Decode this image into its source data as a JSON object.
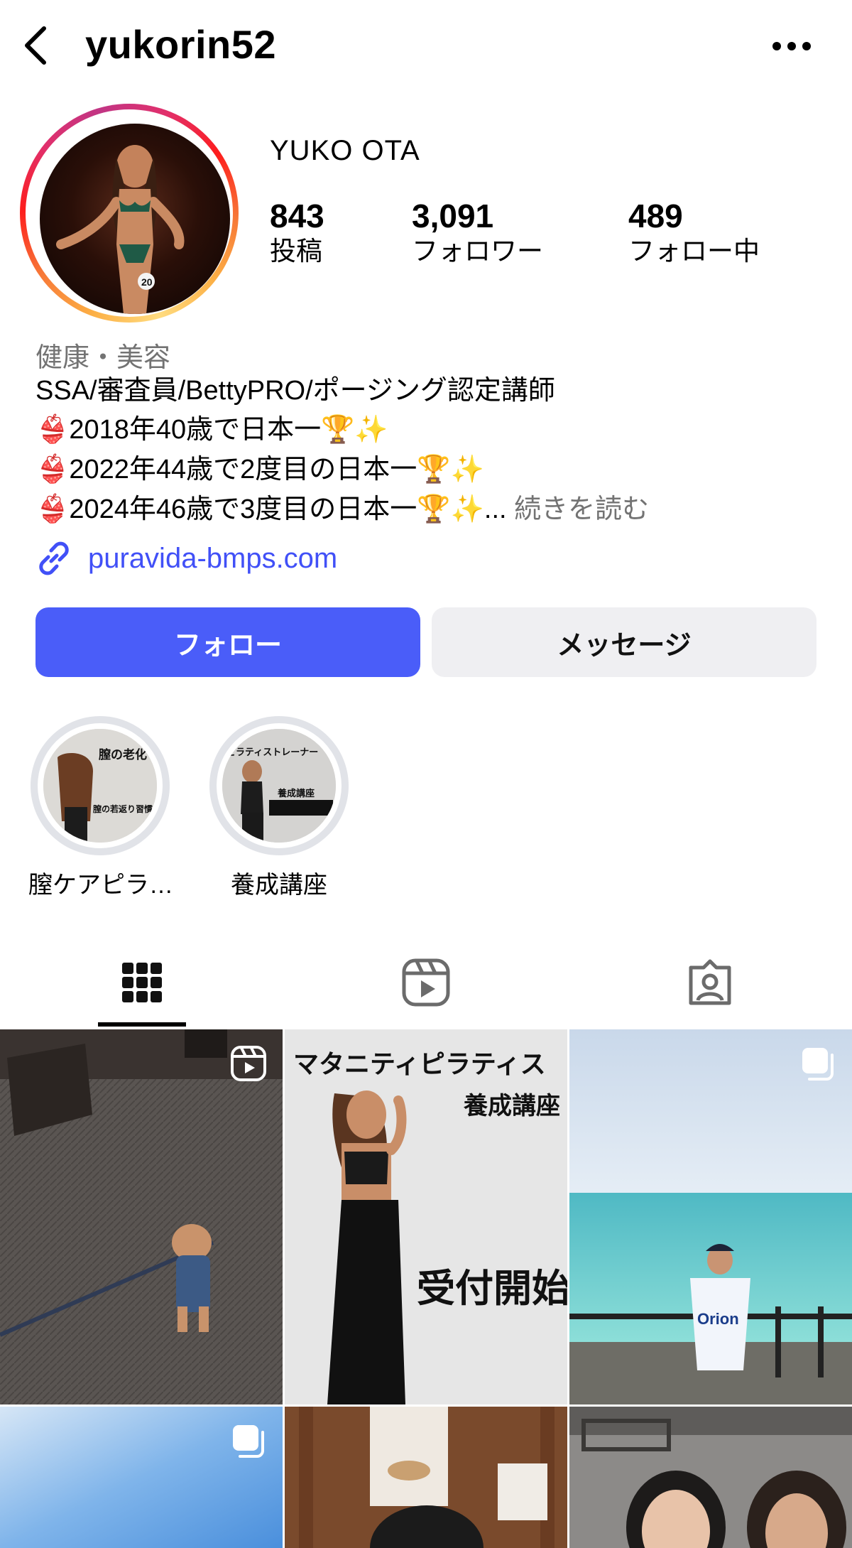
{
  "header": {
    "username": "yukorin52"
  },
  "profile": {
    "display_name": "YUKO OTA",
    "stats": [
      {
        "value": "843",
        "label": "投稿"
      },
      {
        "value": "3,091",
        "label": "フォロワー"
      },
      {
        "value": "489",
        "label": "フォロー中"
      }
    ],
    "category": "健康・美容",
    "bio_lines": [
      "SSA/審査員/BettyPRO/ポージング認定講師",
      "👙2018年40歳で日本一🏆✨",
      "👙2022年44歳で2度目の日本一🏆✨",
      "👙2024年46歳で3度目の日本一🏆✨..."
    ],
    "read_more": "続きを読む",
    "link": "puravida-bmps.com"
  },
  "actions": {
    "follow_label": "フォロー",
    "message_label": "メッセージ"
  },
  "highlights": [
    {
      "label": "膣ケアピラ…",
      "cover_text_1": "膣の老化",
      "cover_text_2": "膣の若返り習慣"
    },
    {
      "label": "養成講座",
      "cover_text_1": "ピラティストレーナー",
      "cover_text_2": "養成講座"
    }
  ],
  "tabs": [
    {
      "icon": "grid-icon",
      "active": true
    },
    {
      "icon": "reels-icon",
      "active": false
    },
    {
      "icon": "tagged-icon",
      "active": false
    }
  ],
  "posts": [
    {
      "badge": "reel-badge-icon",
      "text": ""
    },
    {
      "badge": "",
      "text": "マタニティピラティス",
      "text_2": "養成講座",
      "text_3": "受付開始"
    },
    {
      "badge": "carousel-badge-icon",
      "text": ""
    },
    {
      "badge": "carousel-badge-icon",
      "text": ""
    },
    {
      "badge": "",
      "text": ""
    },
    {
      "badge": "",
      "text": ""
    }
  ],
  "colors": {
    "follow_button": "#4a5df9",
    "message_button": "#efeff2",
    "link": "#4150f7",
    "muted_text": "#737373"
  }
}
